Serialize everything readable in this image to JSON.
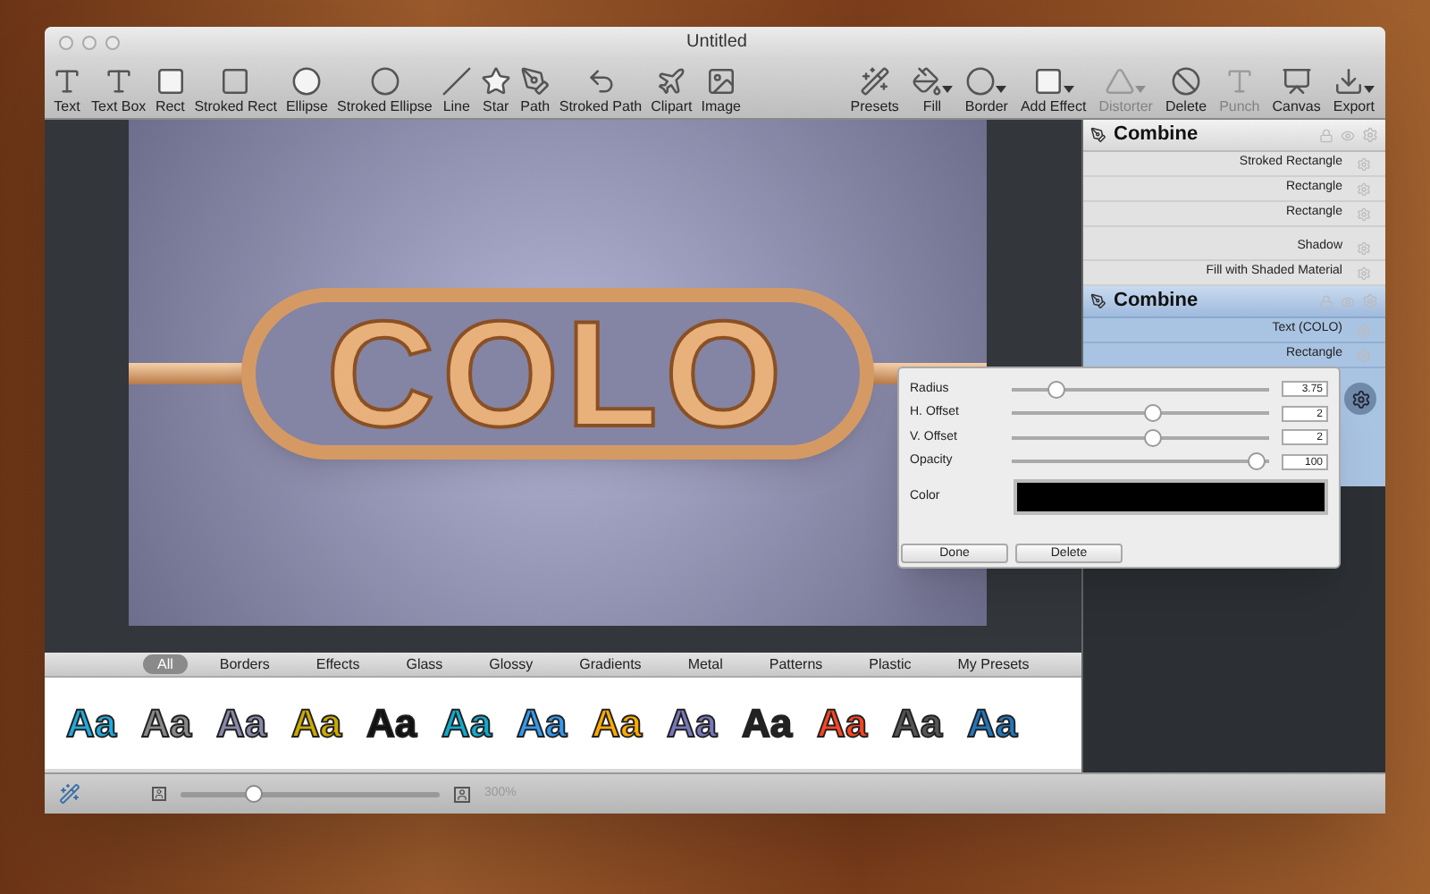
{
  "window": {
    "title": "Untitled"
  },
  "toolbar": [
    {
      "label": "Text",
      "menu": false,
      "disabled": false
    },
    {
      "label": "Text Box",
      "menu": false,
      "disabled": false
    },
    {
      "label": "Rect",
      "menu": false,
      "disabled": false
    },
    {
      "label": "Stroked Rect",
      "menu": false,
      "disabled": false
    },
    {
      "label": "Ellipse",
      "menu": false,
      "disabled": false
    },
    {
      "label": "Stroked Ellipse",
      "menu": false,
      "disabled": false
    },
    {
      "label": "Line",
      "menu": false,
      "disabled": false
    },
    {
      "label": "Star",
      "menu": false,
      "disabled": false
    },
    {
      "label": "Path",
      "menu": false,
      "disabled": false
    },
    {
      "label": "Stroked Path",
      "menu": false,
      "disabled": false
    },
    {
      "label": "Clipart",
      "menu": false,
      "disabled": false
    },
    {
      "label": "Image",
      "menu": false,
      "disabled": false
    }
  ],
  "toolbar_right": [
    {
      "label": "Presets",
      "menu": false,
      "disabled": false
    },
    {
      "label": "Fill",
      "menu": true,
      "disabled": false
    },
    {
      "label": "Border",
      "menu": true,
      "disabled": false
    },
    {
      "label": "Add Effect",
      "menu": true,
      "disabled": false
    },
    {
      "label": "Distorter",
      "menu": true,
      "disabled": true
    },
    {
      "label": "Delete",
      "menu": false,
      "disabled": false
    },
    {
      "label": "Punch",
      "menu": false,
      "disabled": true
    },
    {
      "label": "Canvas",
      "menu": false,
      "disabled": false
    },
    {
      "label": "Export",
      "menu": true,
      "disabled": false
    }
  ],
  "canvas": {
    "artwork_text": "COLO"
  },
  "preset_tabs": [
    {
      "label": "All",
      "selected": true
    },
    {
      "label": "Borders",
      "selected": false
    },
    {
      "label": "Effects",
      "selected": false
    },
    {
      "label": "Glass",
      "selected": false
    },
    {
      "label": "Glossy",
      "selected": false
    },
    {
      "label": "Gradients",
      "selected": false
    },
    {
      "label": "Metal",
      "selected": false
    },
    {
      "label": "Patterns",
      "selected": false
    },
    {
      "label": "Plastic",
      "selected": false
    },
    {
      "label": "My Presets",
      "selected": false
    }
  ],
  "presets": [
    {
      "label": "Aa",
      "color": "#22aadd"
    },
    {
      "label": "Aa",
      "color": "#888888"
    },
    {
      "label": "Aa",
      "color": "#8888aa"
    },
    {
      "label": "Aa",
      "color": "#ccaa00"
    },
    {
      "label": "Aa",
      "color": "#111111"
    },
    {
      "label": "Aa",
      "color": "#11aacc"
    },
    {
      "label": "Aa",
      "color": "#3399ee"
    },
    {
      "label": "Aa",
      "color": "#ffaa00"
    },
    {
      "label": "Aa",
      "color": "#7777bb"
    },
    {
      "label": "Aa",
      "color": "#222222"
    },
    {
      "label": "Aa",
      "color": "#ff4422"
    },
    {
      "label": "Aa",
      "color": "#555555"
    },
    {
      "label": "Aa",
      "color": "#2277bb"
    }
  ],
  "layers": [
    {
      "title": "Combine",
      "selected": false,
      "shapes": [
        "Stroked Rectangle",
        "Rectangle",
        "Rectangle"
      ],
      "effects": [
        "Shadow",
        "Fill with Shaded Material"
      ]
    },
    {
      "title": "Combine",
      "selected": true,
      "shapes": [
        "Text (COLO)",
        "Rectangle"
      ]
    }
  ],
  "popover": {
    "sliders": [
      {
        "label": "Radius",
        "level": 0.15,
        "value": "3.75"
      },
      {
        "label": "H. Offset",
        "level": 0.55,
        "value": "2"
      },
      {
        "label": "V. Offset",
        "level": 0.55,
        "value": "2"
      },
      {
        "label": "Opacity",
        "level": 0.98,
        "value": "100"
      }
    ],
    "color_label": "Color",
    "color": "#000000",
    "buttons": [
      "Done",
      "Delete"
    ]
  },
  "status_bar": {
    "zoom": {
      "level": 0.28,
      "reading": "300%"
    }
  }
}
